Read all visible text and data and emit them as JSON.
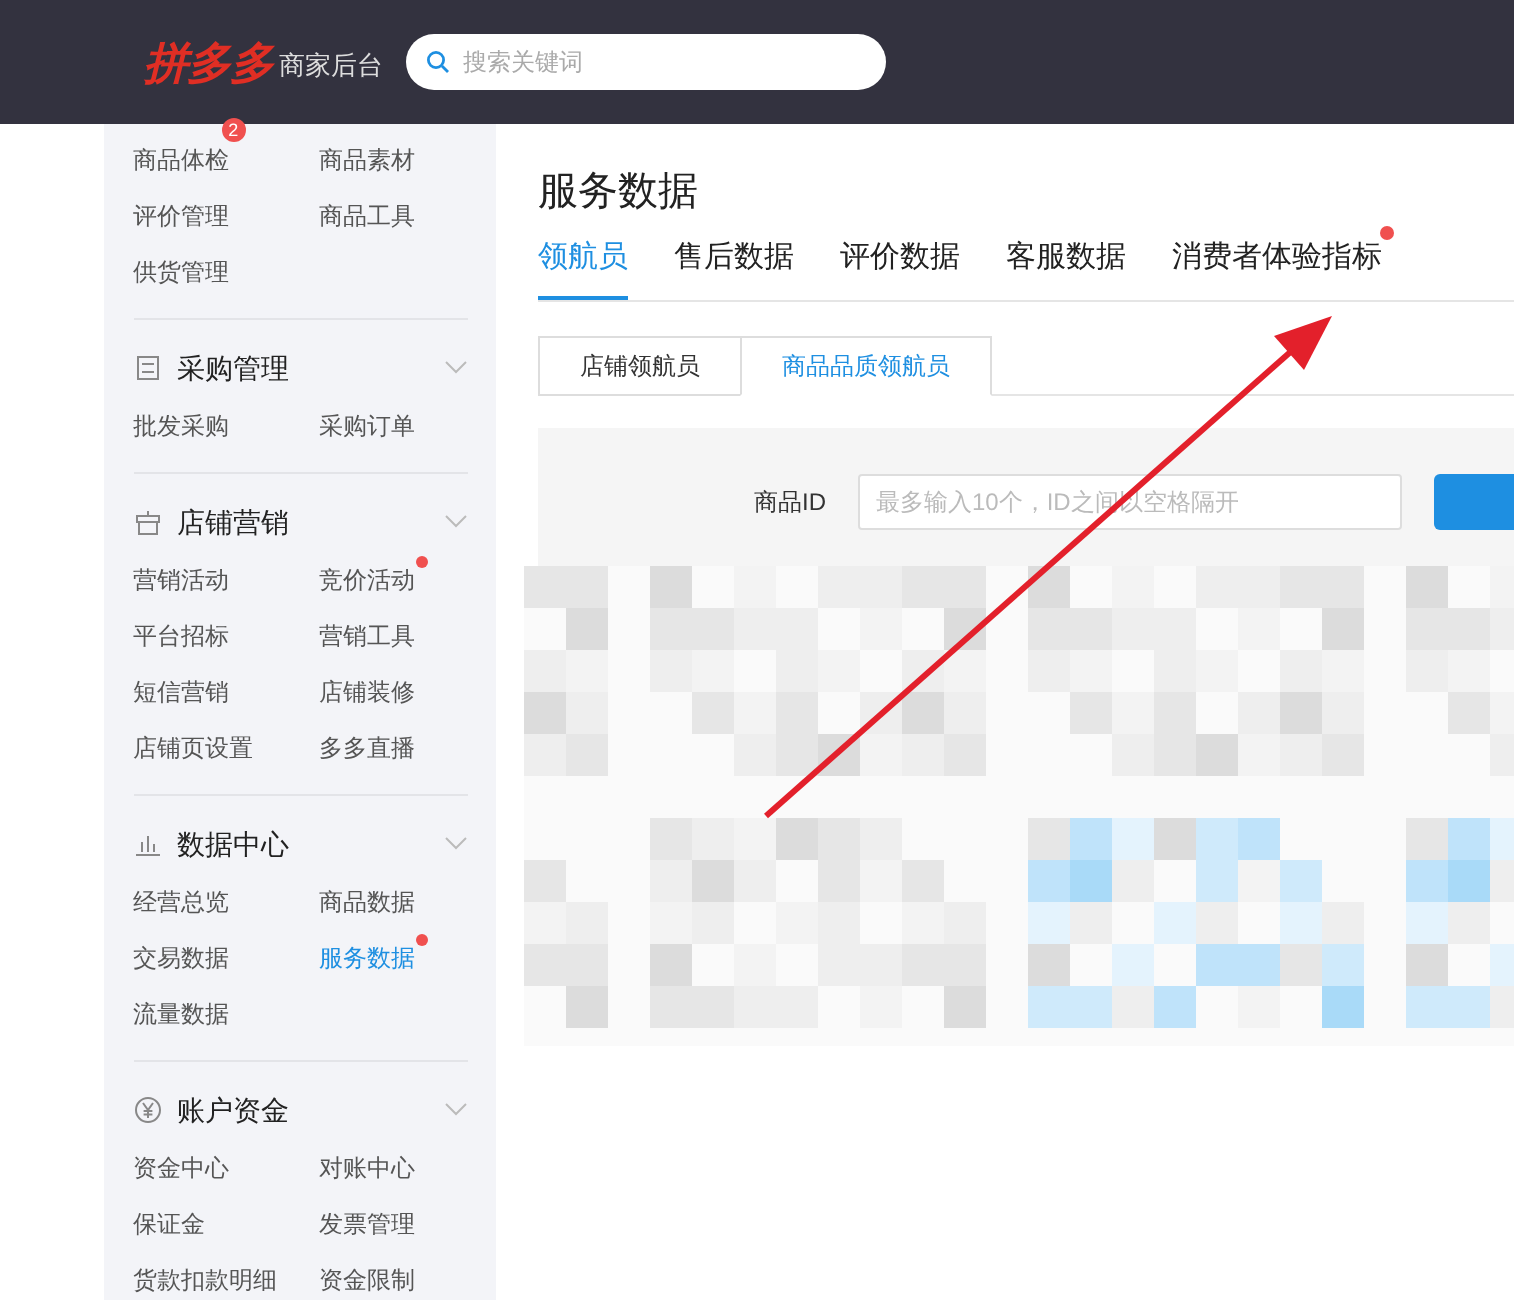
{
  "header": {
    "logo": "拼多多",
    "subtitle": "商家后台",
    "search": {
      "placeholder": "搜索关键词"
    }
  },
  "sidebar": {
    "top_items": [
      {
        "label": "商品体检",
        "selected": false,
        "badge": "2",
        "dot": false
      },
      {
        "label": "商品素材",
        "selected": false,
        "dot": false
      },
      {
        "label": "评价管理",
        "selected": false,
        "dot": false
      },
      {
        "label": "商品工具",
        "selected": false,
        "dot": false
      },
      {
        "label": "供货管理",
        "selected": false,
        "dot": false
      }
    ],
    "sections": [
      {
        "title": "采购管理",
        "expanded": true,
        "items": [
          {
            "label": "批发采购",
            "selected": false,
            "dot": false
          },
          {
            "label": "采购订单",
            "selected": false,
            "dot": false
          }
        ]
      },
      {
        "title": "店铺营销",
        "expanded": true,
        "items": [
          {
            "label": "营销活动",
            "selected": false,
            "dot": false
          },
          {
            "label": "竞价活动",
            "selected": false,
            "dot": true
          },
          {
            "label": "平台招标",
            "selected": false,
            "dot": false
          },
          {
            "label": "营销工具",
            "selected": false,
            "dot": false
          },
          {
            "label": "短信营销",
            "selected": false,
            "dot": false
          },
          {
            "label": "店铺装修",
            "selected": false,
            "dot": false
          },
          {
            "label": "店铺页设置",
            "selected": false,
            "dot": false
          },
          {
            "label": "多多直播",
            "selected": false,
            "dot": false
          }
        ]
      },
      {
        "title": "数据中心",
        "expanded": true,
        "items": [
          {
            "label": "经营总览",
            "selected": false,
            "dot": false
          },
          {
            "label": "商品数据",
            "selected": false,
            "dot": false
          },
          {
            "label": "交易数据",
            "selected": false,
            "dot": false
          },
          {
            "label": "服务数据",
            "selected": true,
            "dot": true
          },
          {
            "label": "流量数据",
            "selected": false,
            "dot": false
          }
        ]
      },
      {
        "title": "账户资金",
        "expanded": true,
        "items": [
          {
            "label": "资金中心",
            "selected": false,
            "dot": false
          },
          {
            "label": "对账中心",
            "selected": false,
            "dot": false
          },
          {
            "label": "保证金",
            "selected": false,
            "dot": false
          },
          {
            "label": "发票管理",
            "selected": false,
            "dot": false
          },
          {
            "label": "货款扣款明细",
            "selected": false,
            "dot": false
          },
          {
            "label": "资金限制",
            "selected": false,
            "dot": false
          }
        ]
      }
    ]
  },
  "main": {
    "title": "服务数据",
    "tabs": [
      {
        "label": "领航员",
        "selected": true,
        "dot": false
      },
      {
        "label": "售后数据",
        "selected": false,
        "dot": false
      },
      {
        "label": "评价数据",
        "selected": false,
        "dot": false
      },
      {
        "label": "客服数据",
        "selected": false,
        "dot": false
      },
      {
        "label": "消费者体验指标",
        "selected": false,
        "dot": true
      }
    ],
    "subtabs": [
      {
        "label": "店铺领航员",
        "selected": false
      },
      {
        "label": "商品品质领航员",
        "selected": true
      }
    ],
    "filter": {
      "label": "商品ID",
      "placeholder": "最多输入10个，ID之间以空格隔开"
    }
  }
}
